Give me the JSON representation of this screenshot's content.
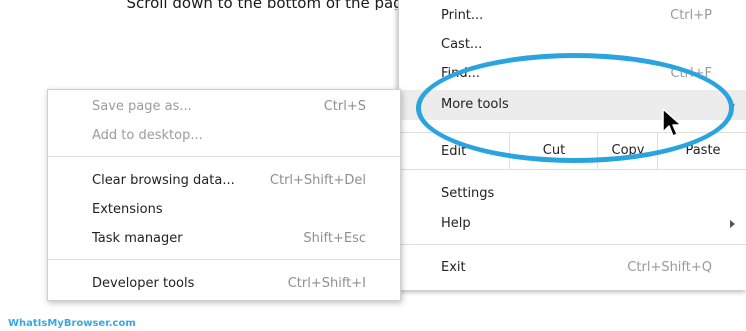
{
  "caption": "Scroll down to the bottom of the page and then click \"Advanced\".",
  "main_menu": {
    "print": {
      "label": "Print...",
      "shortcut": "Ctrl+P"
    },
    "cast": {
      "label": "Cast..."
    },
    "find": {
      "label": "Find...",
      "shortcut": "Ctrl+F"
    },
    "more_tools": {
      "label": "More tools"
    },
    "edit": {
      "label": "Edit",
      "cut": "Cut",
      "copy": "Copy",
      "paste": "Paste"
    },
    "settings": {
      "label": "Settings"
    },
    "help": {
      "label": "Help"
    },
    "exit": {
      "label": "Exit",
      "shortcut": "Ctrl+Shift+Q"
    }
  },
  "sub_menu": {
    "save_page": {
      "label": "Save page as...",
      "shortcut": "Ctrl+S"
    },
    "add_desktop": {
      "label": "Add to desktop..."
    },
    "clear_data": {
      "label": "Clear browsing data...",
      "shortcut": "Ctrl+Shift+Del"
    },
    "extensions": {
      "label": "Extensions"
    },
    "task_manager": {
      "label": "Task manager",
      "shortcut": "Shift+Esc"
    },
    "dev_tools": {
      "label": "Developer tools",
      "shortcut": "Ctrl+Shift+I"
    }
  },
  "watermark": "WhatIsMyBrowser.com",
  "colors": {
    "highlight_ring": "#2aa4df",
    "watermark": "#3aa8e0"
  }
}
